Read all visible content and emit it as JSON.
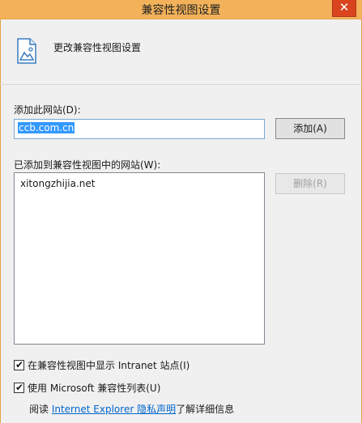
{
  "window": {
    "title": "兼容性视图设置",
    "close_glyph": "✕"
  },
  "header": {
    "icon": "page-settings-icon",
    "text": "更改兼容性视图设置"
  },
  "add_site": {
    "label": "添加此网站(D):",
    "value": "ccb.com.cn",
    "button_label": "添加(A)"
  },
  "added_sites": {
    "label": "已添加到兼容性视图中的网站(W):",
    "items": [
      "xitongzhijia.net"
    ],
    "remove_label": "删除(R)"
  },
  "options": {
    "intranet": {
      "label": "在兼容性视图中显示 Intranet 站点(I)",
      "checked": true
    },
    "ms_list": {
      "label": "使用 Microsoft 兼容性列表(U)",
      "checked": true
    }
  },
  "privacy": {
    "prefix": "阅读 ",
    "link1": "Internet Explorer",
    "space": " ",
    "link2": "隐私声明",
    "suffix": "了解详细信息"
  },
  "colors": {
    "titlebar": "#f3b25a",
    "close": "#d9441f",
    "link": "#0066cc",
    "selection": "#3399ff"
  }
}
